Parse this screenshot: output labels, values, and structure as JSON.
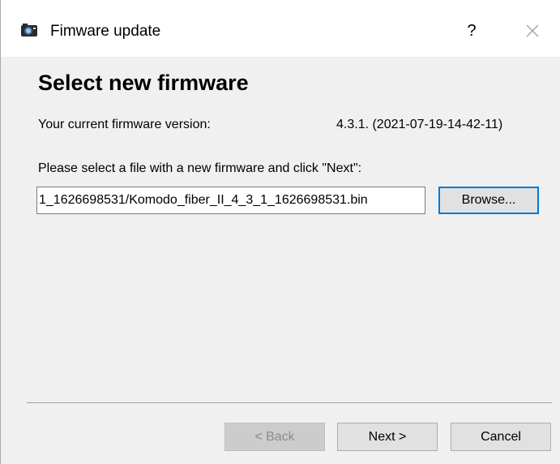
{
  "window": {
    "title": "Fimware update",
    "help_label": "?",
    "title_icon": "camera-icon",
    "close_icon": "close-icon"
  },
  "page": {
    "heading": "Select new firmware",
    "current_label": "Your current firmware version:",
    "current_value": "4.3.1. (2021-07-19-14-42-11)",
    "select_label": "Please select a file with a new firmware and click \"Next\":",
    "file_path": "1_1626698531/Komodo_fiber_II_4_3_1_1626698531.bin",
    "browse_label": "Browse..."
  },
  "footer": {
    "back_label": "< Back",
    "next_label": "Next >",
    "cancel_label": "Cancel"
  },
  "colors": {
    "focus_accent": "#0078d7",
    "dialog_bg": "#f0f0f0"
  }
}
